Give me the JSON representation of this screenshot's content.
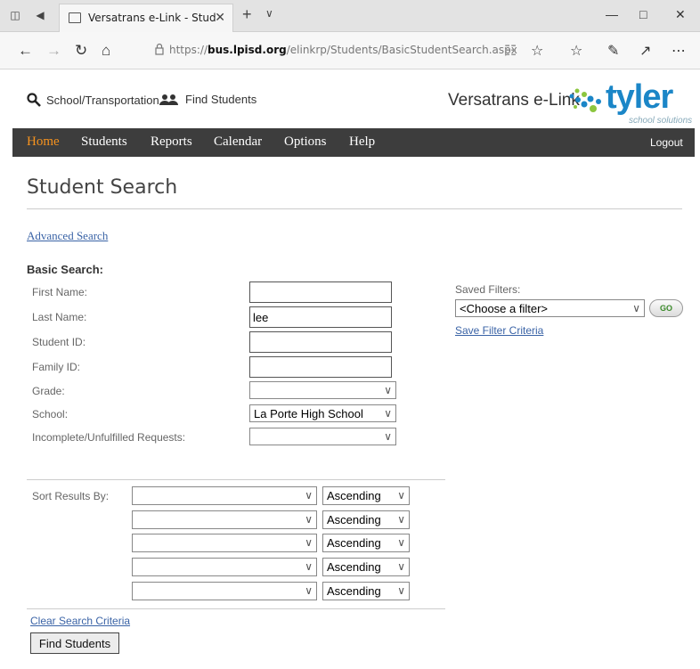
{
  "browser": {
    "tab_title": "Versatrans e-Link - Stud",
    "url_prefix": "https://",
    "url_domain": "bus.lpisd.org",
    "url_path": "/elinkrp/Students/BasicStudentSearch.aspx",
    "icons": [
      "tab-stack-icon",
      "tab-aside-icon",
      "page-icon",
      "close-icon",
      "plus-icon",
      "chevron-down-icon",
      "minimize-icon",
      "maximize-icon",
      "close-window-icon",
      "back-icon",
      "forward-icon",
      "refresh-icon",
      "home-icon",
      "lock-icon",
      "reading-view-icon",
      "favorite-star-icon",
      "favorites-hub-icon",
      "pen-icon",
      "share-icon",
      "more-icon"
    ]
  },
  "header": {
    "school_transport_label": "School/Transportation",
    "find_students_label": "Find Students",
    "brand_text": "Versatrans e-Link",
    "logo_text": "tyler",
    "logo_sub": "school solutions"
  },
  "menu": {
    "items": [
      "Home",
      "Students",
      "Reports",
      "Calendar",
      "Options",
      "Help"
    ],
    "active": "Home",
    "logout": "Logout"
  },
  "page": {
    "title": "Student Search",
    "advanced_link": "Advanced Search",
    "basic_heading": "Basic Search:"
  },
  "form": {
    "first_name_label": "First Name:",
    "first_name_value": "",
    "last_name_label": "Last Name:",
    "last_name_value": "lee",
    "student_id_label": "Student ID:",
    "student_id_value": "",
    "family_id_label": "Family ID:",
    "family_id_value": "",
    "grade_label": "Grade:",
    "grade_value": "",
    "school_label": "School:",
    "school_value": "La Porte High School",
    "incomplete_label": "Incomplete/Unfulfilled Requests:",
    "incomplete_value": ""
  },
  "filters": {
    "label": "Saved Filters:",
    "selected": "<Choose a filter>",
    "go_label": "GO",
    "save_link": "Save Filter Criteria"
  },
  "sort": {
    "label": "Sort Results By:",
    "rows": [
      {
        "field": "",
        "order": "Ascending"
      },
      {
        "field": "",
        "order": "Ascending"
      },
      {
        "field": "",
        "order": "Ascending"
      },
      {
        "field": "",
        "order": "Ascending"
      },
      {
        "field": "",
        "order": "Ascending"
      }
    ]
  },
  "actions": {
    "clear_link": "Clear Search Criteria",
    "find_button": "Find Students"
  },
  "colors": {
    "menu_bg": "#3d3d3d",
    "menu_active": "#f7931e",
    "link": "#3a63a6",
    "tyler_blue": "#1b86c7"
  }
}
